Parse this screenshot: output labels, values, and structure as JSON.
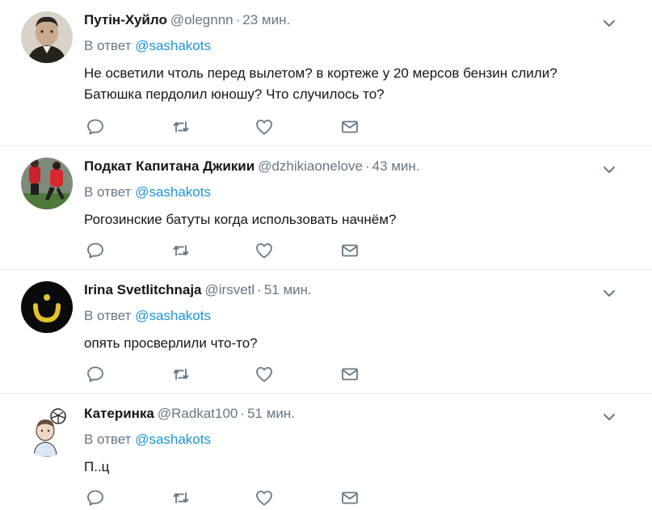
{
  "reply_prefix": "В ответ",
  "tweets": [
    {
      "name": "Путін-Хуйло",
      "handle": "@olegnnn",
      "time": "23 мин.",
      "mention": "@sashakots",
      "text_lines": [
        "Не осветили чтоль перед вылетом? в кортеже у 20 мерсов бензин слили?",
        "Батюшка пердолил юношу? Что случилось то?"
      ]
    },
    {
      "name": "Подкат Капитана Джикии",
      "handle": "@dzhikiaonelove",
      "time": "43 мин.",
      "mention": "@sashakots",
      "text_lines": [
        "Рогозинские батуты когда использовать начнём?"
      ]
    },
    {
      "name": "Irina Svetlitchnaja",
      "handle": "@irsvetl",
      "time": "51 мин.",
      "mention": "@sashakots",
      "text_lines": [
        "опять просверлили что-то?"
      ]
    },
    {
      "name": "Катеринка",
      "handle": "@Radkat100",
      "time": "51 мин.",
      "mention": "@sashakots",
      "text_lines": [
        "П..ц"
      ]
    }
  ],
  "icons": {
    "reply": "reply-icon",
    "retweet": "retweet-icon",
    "like": "heart-icon",
    "dm": "envelope-icon",
    "more": "chevron-down-icon"
  },
  "colors": {
    "text": "#14171a",
    "secondary": "#657786",
    "link": "#1b95e0",
    "border": "#e6ecf0"
  }
}
